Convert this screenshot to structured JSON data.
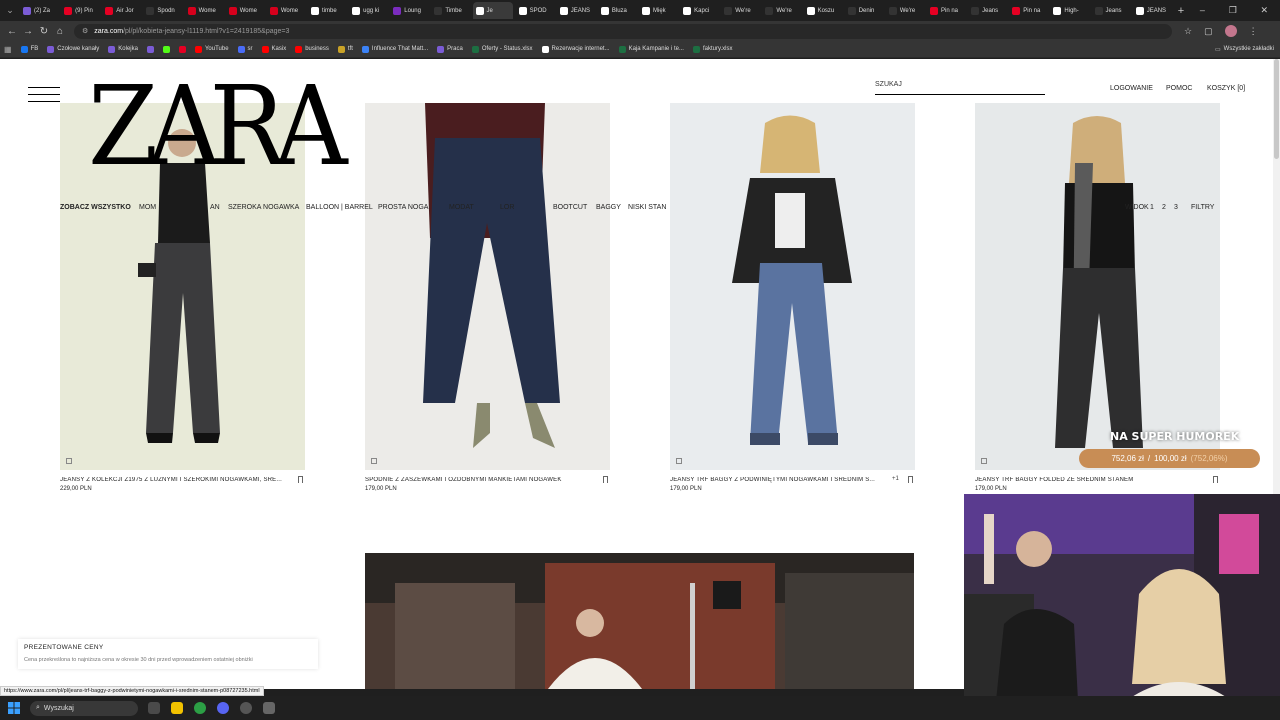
{
  "browser": {
    "tabs": [
      {
        "label": "(2) Za",
        "color": "#7b5cd6"
      },
      {
        "label": "(9) Pin",
        "color": "#e60023"
      },
      {
        "label": "Air Jor",
        "color": "#e60023"
      },
      {
        "label": "Spodn",
        "color": "#333333"
      },
      {
        "label": "Wome",
        "color": "#d6001c"
      },
      {
        "label": "Wome",
        "color": "#d6001c"
      },
      {
        "label": "Wome",
        "color": "#d6001c"
      },
      {
        "label": "timbe",
        "color": "#ffffff"
      },
      {
        "label": "ugg ki",
        "color": "#ffffff"
      },
      {
        "label": "Loung",
        "color": "#7b2cbf"
      },
      {
        "label": "Timbe",
        "color": "#333333"
      },
      {
        "label": "Je",
        "color": "#ffffff",
        "active": true
      },
      {
        "label": "SPOD",
        "color": "#ffffff"
      },
      {
        "label": "JEANS",
        "color": "#ffffff"
      },
      {
        "label": "Bluza",
        "color": "#ffffff"
      },
      {
        "label": "Mięk",
        "color": "#ffffff"
      },
      {
        "label": "Kapci",
        "color": "#ffffff"
      },
      {
        "label": "We're",
        "color": "#333333"
      },
      {
        "label": "We're",
        "color": "#333333"
      },
      {
        "label": "Koszu",
        "color": "#ffffff"
      },
      {
        "label": "Denin",
        "color": "#333333"
      },
      {
        "label": "We're",
        "color": "#333333"
      },
      {
        "label": "Pin na",
        "color": "#e60023"
      },
      {
        "label": "Jeans",
        "color": "#333333"
      },
      {
        "label": "Pin na",
        "color": "#e60023"
      },
      {
        "label": "High-",
        "color": "#ffffff"
      },
      {
        "label": "Jeans",
        "color": "#333333"
      },
      {
        "label": "JEANS",
        "color": "#ffffff"
      }
    ],
    "new_tab": "+",
    "window_controls": [
      "–",
      "❐",
      "✕"
    ],
    "url_host": "zara.com",
    "url_rest": "/pl/pl/kobieta-jeansy-l1119.html?v1=2419185&page=3",
    "bookmarks": [
      {
        "label": "FB",
        "color": "#1877f2"
      },
      {
        "label": "Czołowe kanały",
        "color": "#7b5cd6"
      },
      {
        "label": "Kolejka",
        "color": "#7b5cd6"
      },
      {
        "label": "",
        "color": "#7b5cd6"
      },
      {
        "label": "",
        "color": "#53fc18"
      },
      {
        "label": "",
        "color": "#e60023"
      },
      {
        "label": "YouTube",
        "color": "#ff0000"
      },
      {
        "label": "sr",
        "color": "#4a6cf7"
      },
      {
        "label": "Kasix",
        "color": "#ff0000"
      },
      {
        "label": "business",
        "color": "#ff0000"
      },
      {
        "label": "tft",
        "color": "#c9a227"
      },
      {
        "label": "Influence That Matt...",
        "color": "#3b82f6"
      },
      {
        "label": "Praca",
        "color": "#7b5cd6"
      },
      {
        "label": "Oferty - Status.xlsx",
        "color": "#1d6f42"
      },
      {
        "label": "Rezerwacje internet...",
        "color": "#ffffff"
      },
      {
        "label": "Kaja Kampanie i te...",
        "color": "#1d6f42"
      },
      {
        "label": "faktury.xlsx",
        "color": "#1d6f42"
      }
    ],
    "all_bookmarks": "Wszystkie zakładki"
  },
  "header": {
    "logo": "ZARA",
    "search_placeholder": "SZUKAJ",
    "login": "LOGOWANIE",
    "help": "POMOC",
    "cart": "KOSZYK [0]"
  },
  "categories": [
    {
      "label": "ZOBACZ WSZYSTKO",
      "active": true
    },
    {
      "label": "MOM"
    },
    {
      "label": "AN"
    },
    {
      "label": "SZEROKA NOGAWKA"
    },
    {
      "label": "BALLOON | BARREL"
    },
    {
      "label": "PROSTA NOGA"
    },
    {
      "label": "MODAT"
    },
    {
      "label": "LOR"
    },
    {
      "label": "BOOTCUT"
    },
    {
      "label": "BAGGY"
    },
    {
      "label": "NISKI STAN"
    }
  ],
  "pagination": {
    "label": "WIDOK",
    "pages": [
      "1",
      "2",
      "3"
    ],
    "filters": "FILTRY"
  },
  "products": [
    {
      "title": "JEANSY Z KOLEKCJI Z1975 Z LUŹNYMI I SZEROKIMI NOGAWKAMI, ŚRE...",
      "price": "229,00 PLN",
      "bg": "#e8ead8",
      "extra": ""
    },
    {
      "title": "SPODNIE Z ZASZEWKAMI I OZDOBNYMI MANKIETAMI NOGAWEK",
      "price": "179,00 PLN",
      "bg": "#ecebe8",
      "extra": ""
    },
    {
      "title": "JEANSY TRF BAGGY Z PODWINIĘTYMI NOGAWKAMI I ŚREDNIM S...",
      "price": "179,00 PLN",
      "bg": "#e9ecee",
      "extra": "+1"
    },
    {
      "title": "JEANSY TRF BAGGY FOLDED ZE ŚREDNIM STANEM",
      "price": "179,00 PLN",
      "bg": "#e6e9ea",
      "extra": ""
    }
  ],
  "overlay": {
    "title": "NA SUPER HUMOREK",
    "amount": "752,06 zł",
    "separator": "/",
    "goal": "100,00 zł",
    "percent": "(752,06%)"
  },
  "notice": {
    "title": "PREZENTOWANE CENY",
    "desc": "Cena przekreślona to najniższa cena w okresie 30 dni przed wprowadzeniem ostatniej obniżki"
  },
  "status_url": "https://www.zara.com/pl/pl/jeans-trf-baggy-z-podwinietymi-nogawkami-i-srednim-stanem-p08727235.html",
  "taskbar": {
    "search": "Wyszukaj"
  }
}
